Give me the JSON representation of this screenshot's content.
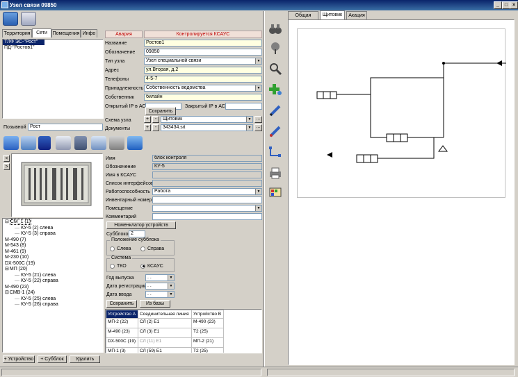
{
  "window": {
    "title": "Узел связи 09850",
    "min_label": "_",
    "max_label": "□",
    "close_label": "×"
  },
  "left_tabs": [
    "Территория",
    "Сети",
    "Помещения",
    "Инфо"
  ],
  "left_tree_items": [
    "ТЛФ ЭС-\"Рост\"",
    "ПД-\"Ростов1\""
  ],
  "callsign": {
    "label": "Позывной",
    "value": "Рост"
  },
  "status": {
    "alarm": "Авария",
    "control": "Контролируется КСАУС"
  },
  "node_form": {
    "name": {
      "label": "Название",
      "value": "Ростов1"
    },
    "designation": {
      "label": "Обозначение",
      "value": "09850"
    },
    "type": {
      "label": "Тип узла",
      "value": "Узел специальной связи"
    },
    "address": {
      "label": "Адрес",
      "value": "ул.Вторая, д.2"
    },
    "phones": {
      "label": "Телефоны",
      "value": "4-5-7"
    },
    "ownership": {
      "label": "Принадлежность",
      "value": "Собственность ведомства"
    },
    "owner": {
      "label": "Собственник",
      "value": "билайн"
    },
    "open_ip": {
      "label": "Открытый IP в АСУ",
      "value": ""
    },
    "closed_ip": {
      "label": "Закрытый IP в АСУ",
      "value": ""
    },
    "save_label": "Сохранить",
    "scheme": {
      "label": "Схема узла",
      "value": "Щитовик",
      "plus": "+",
      "minus": "-",
      "more": "..."
    },
    "docs": {
      "label": "Документы",
      "value": "343434.sit",
      "plus": "+",
      "minus": "-",
      "more": "..."
    }
  },
  "device_form": {
    "name": {
      "label": "Имя",
      "value": "блок контроля"
    },
    "designation": {
      "label": "Обозначение",
      "value": "КУ-5"
    },
    "ksaus_name": {
      "label": "Имя в КСАУС",
      "value": ""
    },
    "interfaces": {
      "label": "Список интерфейсов",
      "value": ""
    },
    "state": {
      "label": "Работоспособность",
      "value": "Работа"
    },
    "inventory": {
      "label": "Инвентарный номер",
      "value": ""
    },
    "room": {
      "label": "Помещение",
      "value": ""
    },
    "comment": {
      "label": "Комментарий",
      "value": ""
    }
  },
  "device_tree": [
    {
      "text": "СМ_1 (1)",
      "level": 0,
      "box": "⊟"
    },
    {
      "text": "КУ-5 (2) слева",
      "level": 1
    },
    {
      "text": "КУ-5 (3) справа",
      "level": 1
    },
    {
      "text": "М-490 (7)",
      "level": 0
    },
    {
      "text": "М-543 (8)",
      "level": 0
    },
    {
      "text": "М-461 (9)",
      "level": 0
    },
    {
      "text": "М-230 (10)",
      "level": 0
    },
    {
      "text": "DX-500С (19)",
      "level": 0
    },
    {
      "text": "МП (20)",
      "level": 0,
      "box": "⊟"
    },
    {
      "text": "КУ-5 (21) слева",
      "level": 1
    },
    {
      "text": "КУ-5 (22) справа",
      "level": 1
    },
    {
      "text": "М-490 (23)",
      "level": 0
    },
    {
      "text": "СМВ-1 (24)",
      "level": 0,
      "box": "⊟"
    },
    {
      "text": "КУ-5 (25) слева",
      "level": 1
    },
    {
      "text": "КУ-5 (26) справа",
      "level": 1
    }
  ],
  "slot_panel": {
    "nomenclator_label": "Номенклатор устройств",
    "subblocks": {
      "label": "Субблоков",
      "value": "2"
    },
    "position": {
      "title": "Положение субблока",
      "left": "Слева",
      "right": "Справа"
    },
    "system": {
      "title": "Система",
      "tko": "ТКО",
      "ksaus": "КСАУС"
    },
    "year": {
      "label": "Год выпуска",
      "value": ". ."
    },
    "reg_date": {
      "label": "Дата регистрации",
      "value": ". ."
    },
    "input_date": {
      "label": "Дата ввода",
      "value": ". ."
    },
    "save_label": "Сохранить",
    "from_db_label": "Из базы"
  },
  "connections": {
    "headers": [
      "Устройство А",
      "Соединительная линия",
      "Устройство В"
    ],
    "rows": [
      [
        "МП-2 (22)",
        "СЛ (2) Е1",
        "М-490 (23)"
      ],
      [
        "М-490 (23)",
        "СЛ (3) Е1",
        "Т2 (25)"
      ],
      [
        "DX-500С (19)",
        "СЛ (11) Е1",
        "МП-2 (21)"
      ],
      [
        "МП-1 (3)",
        "СЛ (59) Е1",
        "Т2 (25)"
      ]
    ]
  },
  "bottom_buttons": {
    "add_device": "+ Устройство",
    "add_subblock": "+ Субблок",
    "delete": "Удалить"
  },
  "right_tabs": [
    "Общая схема",
    "Щитовик",
    "Акация"
  ]
}
